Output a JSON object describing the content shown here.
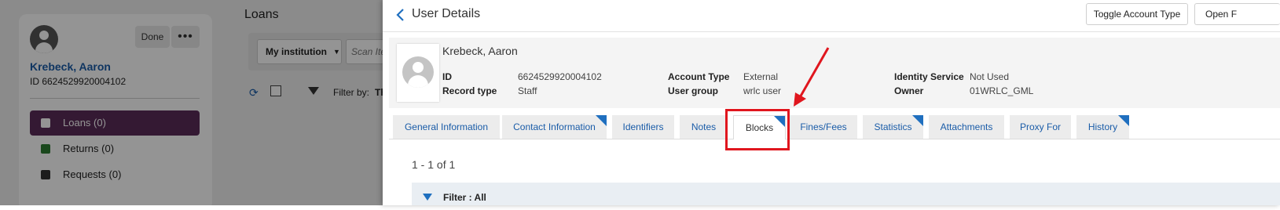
{
  "background": {
    "user_card": {
      "done_label": "Done",
      "more_label": "•••",
      "name": "Krebeck, Aaron",
      "id_text": "ID 6624529920004102",
      "nav": [
        {
          "label": "Loans (0)",
          "icon": "loans-icon",
          "active": true
        },
        {
          "label": "Returns (0)",
          "icon": "returns-icon",
          "active": false
        },
        {
          "label": "Requests (0)",
          "icon": "requests-icon",
          "active": false
        }
      ]
    },
    "loans": {
      "title": "Loans",
      "institution": "My institution",
      "scan_placeholder": "Scan Ite",
      "filter_label": "Filter by:",
      "filter_value": "Th"
    }
  },
  "panel": {
    "title": "User Details",
    "header_buttons": [
      "Toggle Account Type",
      "Open F"
    ],
    "user": {
      "name": "Krebeck, Aaron",
      "fields": [
        {
          "label": "ID",
          "value": "6624529920004102"
        },
        {
          "label": "Record type",
          "value": "Staff"
        },
        {
          "label": "Account Type",
          "value": "External"
        },
        {
          "label": "User group",
          "value": "wrlc user"
        },
        {
          "label": "Identity Service",
          "value": "Not Used"
        },
        {
          "label": "Owner",
          "value": "01WRLC_GML"
        }
      ]
    },
    "tabs": [
      {
        "label": "General Information",
        "marked": false,
        "active": false
      },
      {
        "label": "Contact Information",
        "marked": true,
        "active": false
      },
      {
        "label": "Identifiers",
        "marked": false,
        "active": false
      },
      {
        "label": "Notes",
        "marked": false,
        "active": false
      },
      {
        "label": "Blocks",
        "marked": true,
        "active": true
      },
      {
        "label": "Fines/Fees",
        "marked": false,
        "active": false
      },
      {
        "label": "Statistics",
        "marked": true,
        "active": false
      },
      {
        "label": "Attachments",
        "marked": false,
        "active": false
      },
      {
        "label": "Proxy For",
        "marked": false,
        "active": false
      },
      {
        "label": "History",
        "marked": true,
        "active": false
      }
    ],
    "results_count": "1 - 1 of 1",
    "filter_text": "Filter : All"
  },
  "colors": {
    "accent": "#1a5ca8",
    "active_nav": "#5b2b59",
    "annotation": "#e0161e",
    "tab_marker": "#1f6fbf"
  }
}
